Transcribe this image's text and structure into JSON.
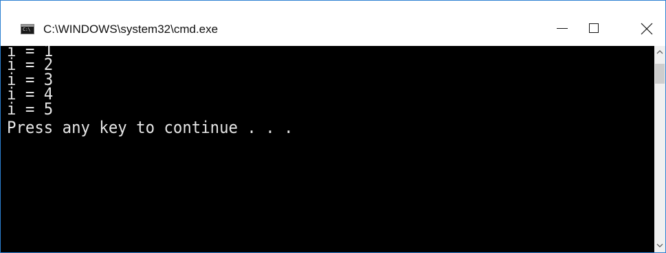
{
  "window": {
    "title": "C:\\WINDOWS\\system32\\cmd.exe",
    "app_icon_text": "C:\\"
  },
  "console": {
    "lines": [
      "i = 1",
      "i = 2",
      "i = 3",
      "i = 4",
      "i = 5",
      "Press any key to continue . . ."
    ]
  },
  "icons": {
    "app": "cmd-icon",
    "minimize": "minimize-icon",
    "maximize": "maximize-icon",
    "close": "close-icon",
    "scroll_up": "chevron-up-icon",
    "scroll_down": "chevron-down-icon"
  },
  "colors": {
    "console_background": "#000000",
    "console_text": "#e6e6e6",
    "window_border": "#2b7fd1"
  }
}
